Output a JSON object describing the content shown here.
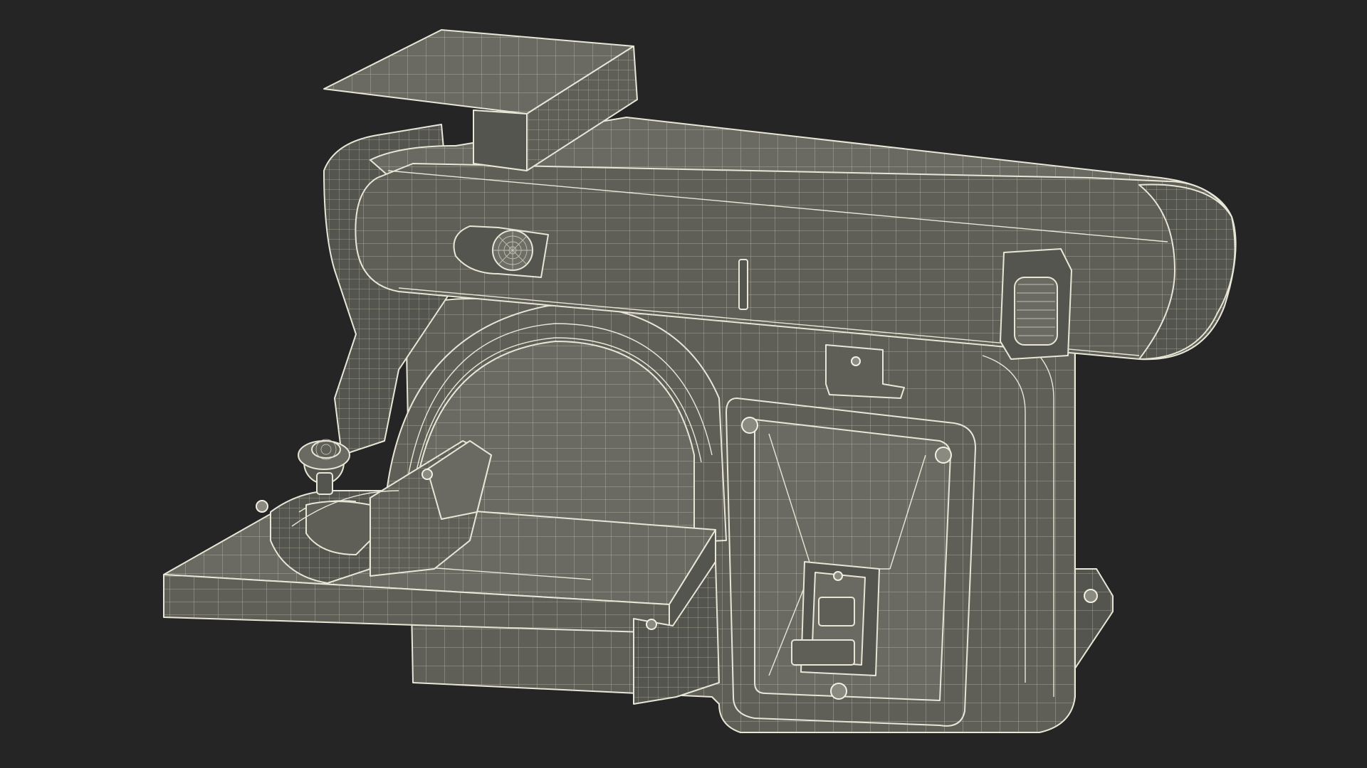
{
  "scene": {
    "subject": "belt-disc-sander-wireframe",
    "background_color": "#252525",
    "surface_color": "#5f5f58",
    "wire_color": "#e8e6d6"
  }
}
